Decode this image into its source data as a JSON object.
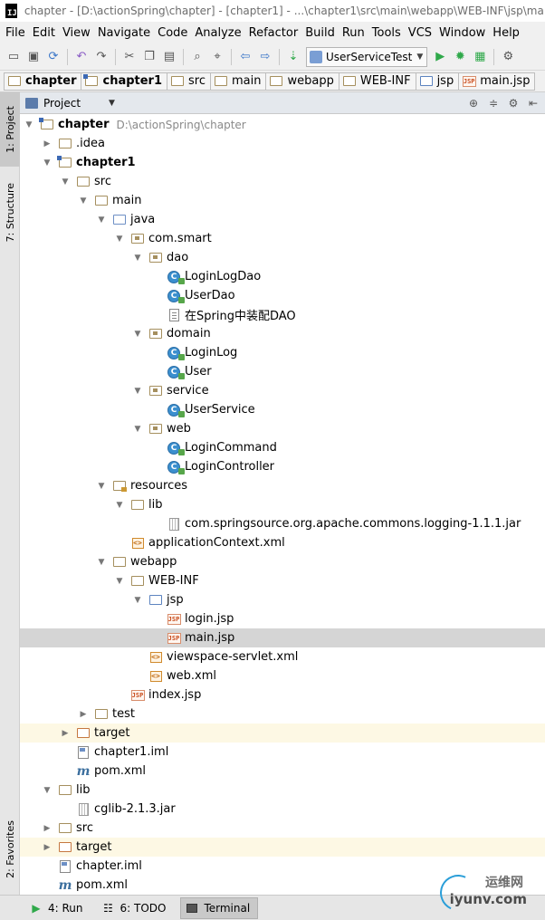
{
  "window": {
    "title": "chapter - [D:\\actionSpring\\chapter] - [chapter1] - ...\\chapter1\\src\\main\\webapp\\WEB-INF\\jsp\\main"
  },
  "menu": [
    "File",
    "Edit",
    "View",
    "Navigate",
    "Code",
    "Analyze",
    "Refactor",
    "Build",
    "Run",
    "Tools",
    "VCS",
    "Window",
    "Help"
  ],
  "toolbar": {
    "run_config": "UserServiceTest"
  },
  "breadcrumbs": [
    "chapter",
    "chapter1",
    "src",
    "main",
    "webapp",
    "WEB-INF",
    "jsp",
    "main.jsp"
  ],
  "left_tabs": {
    "project": "1: Project",
    "structure": "7: Structure",
    "favorites": "2: Favorites"
  },
  "panel": {
    "title": "Project"
  },
  "tree": [
    {
      "label": "chapter",
      "hint": "D:\\actionSpring\\chapter"
    },
    {
      "label": ".idea"
    },
    {
      "label": "chapter1"
    },
    {
      "label": "src"
    },
    {
      "label": "main"
    },
    {
      "label": "java"
    },
    {
      "label": "com.smart"
    },
    {
      "label": "dao"
    },
    {
      "label": "LoginLogDao"
    },
    {
      "label": "UserDao"
    },
    {
      "label": "在Spring中装配DAO"
    },
    {
      "label": "domain"
    },
    {
      "label": "LoginLog"
    },
    {
      "label": "User"
    },
    {
      "label": "service"
    },
    {
      "label": "UserService"
    },
    {
      "label": "web"
    },
    {
      "label": "LoginCommand"
    },
    {
      "label": "LoginController"
    },
    {
      "label": "resources"
    },
    {
      "label": "lib"
    },
    {
      "label": "com.springsource.org.apache.commons.logging-1.1.1.jar"
    },
    {
      "label": "applicationContext.xml"
    },
    {
      "label": "webapp"
    },
    {
      "label": "WEB-INF"
    },
    {
      "label": "jsp"
    },
    {
      "label": "login.jsp"
    },
    {
      "label": "main.jsp"
    },
    {
      "label": "viewspace-servlet.xml"
    },
    {
      "label": "web.xml"
    },
    {
      "label": "index.jsp"
    },
    {
      "label": "test"
    },
    {
      "label": "target"
    },
    {
      "label": "chapter1.iml"
    },
    {
      "label": "pom.xml"
    },
    {
      "label": "lib"
    },
    {
      "label": "cglib-2.1.3.jar"
    },
    {
      "label": "src"
    },
    {
      "label": "target"
    },
    {
      "label": "chapter.iml"
    },
    {
      "label": "pom.xml"
    }
  ],
  "bottom_tabs": {
    "run": "4: Run",
    "todo": "6: TODO",
    "terminal": "Terminal"
  },
  "watermark": {
    "cn": "运维网",
    "url": "iyunv.com"
  }
}
